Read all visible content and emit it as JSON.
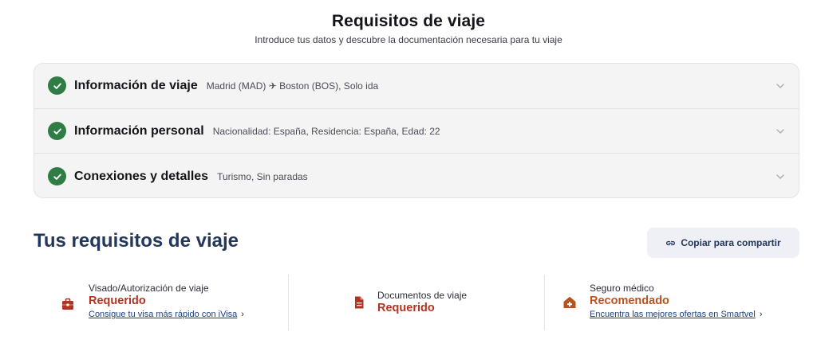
{
  "header": {
    "title": "Requisitos de viaje",
    "subtitle": "Introduce tus datos y descubre la documentación necesaria para tu viaje"
  },
  "accordion": [
    {
      "title": "Información de viaje",
      "summary": "Madrid (MAD) ✈ Boston (BOS), Solo ida"
    },
    {
      "title": "Información personal",
      "summary": "Nacionalidad: España, Residencia: España, Edad: 22"
    },
    {
      "title": "Conexiones y detalles",
      "summary": "Turismo, Sin paradas"
    }
  ],
  "requirements_section": {
    "title": "Tus requisitos de viaje",
    "share_label": "Copiar para compartir"
  },
  "requirements": [
    {
      "label": "Visado/Autorización de viaje",
      "status": "Requerido",
      "link": "Consigue tu visa más rápido con iVisa",
      "icon": "briefcase-icon"
    },
    {
      "label": "Documentos de viaje",
      "status": "Requerido",
      "icon": "document-icon"
    },
    {
      "label": "Seguro médico",
      "status": "Recomendado",
      "link": "Encuentra las mejores ofertas en Smartvel",
      "icon": "medical-house-icon"
    }
  ],
  "colors": {
    "check": "#2f7d45",
    "required": "#b33321",
    "recommended": "#b8531d",
    "heading": "#22375c"
  }
}
